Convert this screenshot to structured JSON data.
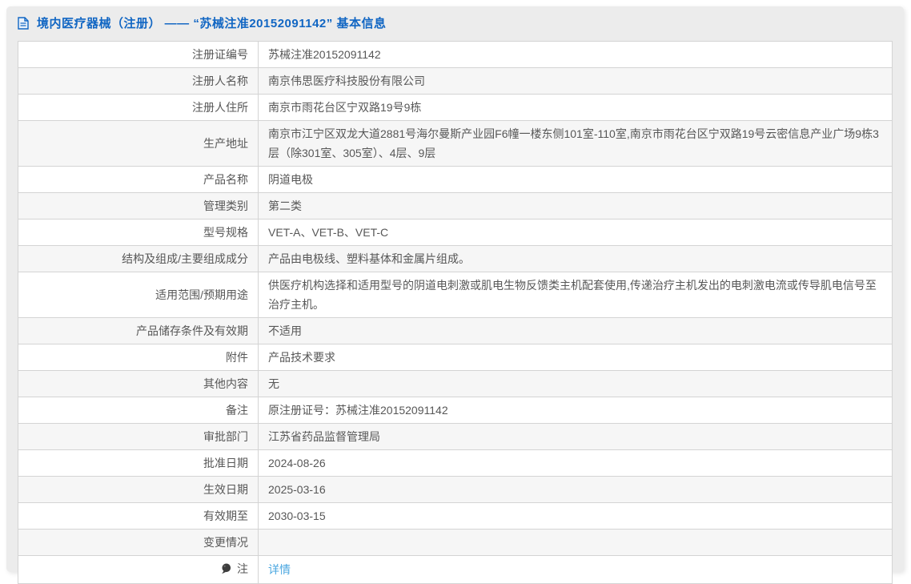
{
  "header": {
    "icon": "document-icon",
    "title": "境内医疗器械（注册） —— “苏械注准20152091142” 基本信息"
  },
  "colors": {
    "title_blue": "#1166c3",
    "link_blue": "#4ba7e0",
    "card_background": "#ececec",
    "row_alt_background": "#f6f6f6",
    "border": "#d4d4d4",
    "text": "#575757"
  },
  "table": {
    "rows": [
      {
        "label": "注册证编号",
        "value": "苏械注准20152091142"
      },
      {
        "label": "注册人名称",
        "value": "南京伟思医疗科技股份有限公司"
      },
      {
        "label": "注册人住所",
        "value": "南京市雨花台区宁双路19号9栋"
      },
      {
        "label": "生产地址",
        "value": "南京市江宁区双龙大道2881号海尔曼斯产业园F6幢一楼东侧101室-110室,南京市雨花台区宁双路19号云密信息产业广场9栋3层（除301室、305室）、4层、9层"
      },
      {
        "label": "产品名称",
        "value": "阴道电极"
      },
      {
        "label": "管理类别",
        "value": "第二类"
      },
      {
        "label": "型号规格",
        "value": "VET-A、VET-B、VET-C"
      },
      {
        "label": "结构及组成/主要组成成分",
        "value": "产品由电极线、塑料基体和金属片组成。"
      },
      {
        "label": "适用范围/预期用途",
        "value": "供医疗机构选择和适用型号的阴道电刺激或肌电生物反馈类主机配套使用,传递治疗主机发出的电刺激电流或传导肌电信号至治疗主机。"
      },
      {
        "label": "产品储存条件及有效期",
        "value": "不适用"
      },
      {
        "label": "附件",
        "value": "产品技术要求"
      },
      {
        "label": "其他内容",
        "value": "无"
      },
      {
        "label": "备注",
        "value": "原注册证号：苏械注准20152091142"
      },
      {
        "label": "审批部门",
        "value": "江苏省药品监督管理局"
      },
      {
        "label": "批准日期",
        "value": "2024-08-26"
      },
      {
        "label": "生效日期",
        "value": "2025-03-16"
      },
      {
        "label": "有效期至",
        "value": "2030-03-15"
      },
      {
        "label": "变更情况",
        "value": ""
      },
      {
        "label": "注",
        "label_icon": "balloon-icon",
        "value": "详情",
        "link": true
      }
    ]
  }
}
